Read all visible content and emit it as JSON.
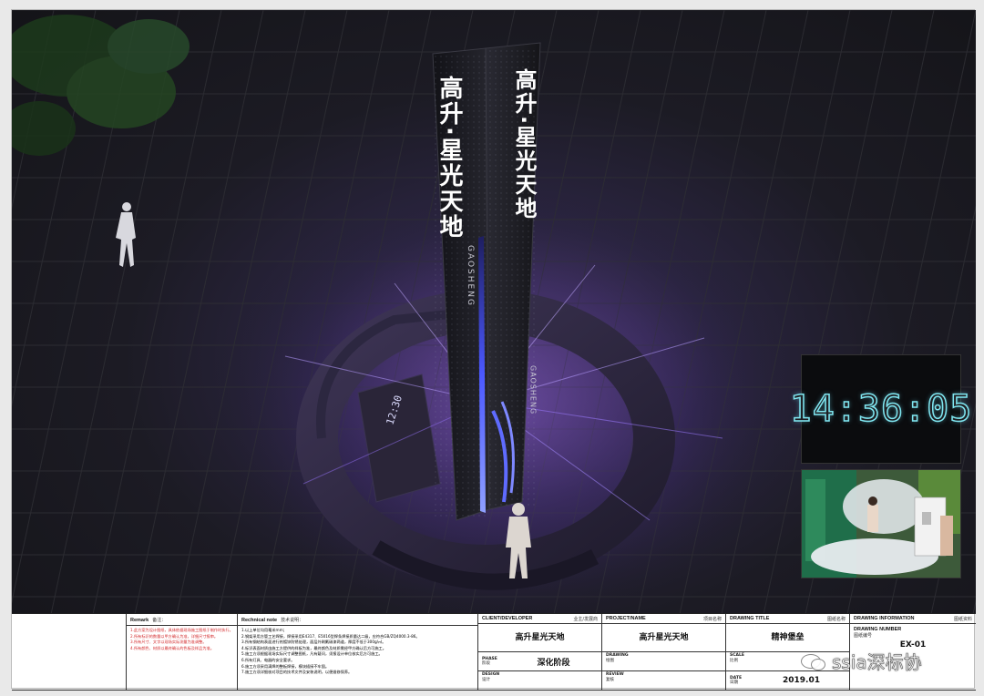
{
  "render": {
    "sign_text_front": "高升·星光天地",
    "sign_brand_front": "GAOSHENG",
    "sign_text_side": "高升·星光天地",
    "sign_brand_side": "GAOSHENG",
    "base_clock": "12:30"
  },
  "clock_inset": {
    "time": "14:36:05"
  },
  "remark": {
    "title_en": "Remark",
    "title_cn": "备注：",
    "lines": [
      "1.此方案为设计图纸，具体依据现场施工图纸于制作时执行。",
      "2.所有标识的数量以甲方确认为准，详细尺寸报审。",
      "3.所有尺寸、文字以现场实际测量为准调整。",
      "4.所有颜色、材质以最终确认的色板及样品为准。"
    ]
  },
  "technical": {
    "title_en": "Rechnical note",
    "title_cn": "技术说明：",
    "lines": [
      "1.以上单位均用毫米mm；",
      "2.钢架采用方管工艺焊接，焊接采用E4317、E5016型焊条焊接质量达二级，应符合GB/ZQ4000.3-86。",
      "3.所有钢结构表面进行热镀锌防锈处理，面层外刷氟碳漆两道，厚度不低于300g/㎡。",
      "4.标识表面材质由施工方提供的样板为准，最终颜色及材质需经甲方确认后方可施工。",
      "5.施工方须根据现场实际尺寸调整图纸，凡有疑问，须报设计单位核实后方可施工。",
      "6.所有灯具、电器的安全要求。",
      "6.施工方须采用满焊的整板焊接，模块插接不牢固。",
      "7.施工方须详细核对项目的技术文件及安装说明，以便维修保养。"
    ]
  },
  "client": {
    "label_en": "CLIENT/DEVELOPER",
    "label_cn": "业主/发展商",
    "value": "高升星光天地"
  },
  "project": {
    "label_en": "PROJECT/NAME",
    "label_cn": "项目名称",
    "value": "高升星光天地"
  },
  "drawing_title": {
    "label_en": "DRAWING TITLE",
    "label_cn": "图纸名称",
    "value": "精神堡垒"
  },
  "drawing_info": {
    "label_en": "DRAWING INFORMATION",
    "label_cn": "图纸资料",
    "number_label_en": "DRAWING NUMBER",
    "number_label_cn": "图纸编号",
    "number": "EX-01"
  },
  "phase": {
    "label_en": "PHASE",
    "label_cn": "阶段",
    "value": "深化阶段"
  },
  "drawing": {
    "label_en": "DRAWING",
    "label_cn": "绘图"
  },
  "scale": {
    "label_en": "SCALE",
    "label_cn": "比例"
  },
  "design": {
    "label_en": "DESIGN",
    "label_cn": "设计"
  },
  "review": {
    "label_en": "REVIEW",
    "label_cn": "复核"
  },
  "date": {
    "label_en": "DATE",
    "label_cn": "日期",
    "value": "2019.01"
  },
  "watermark": {
    "text": "ssia深标协"
  }
}
